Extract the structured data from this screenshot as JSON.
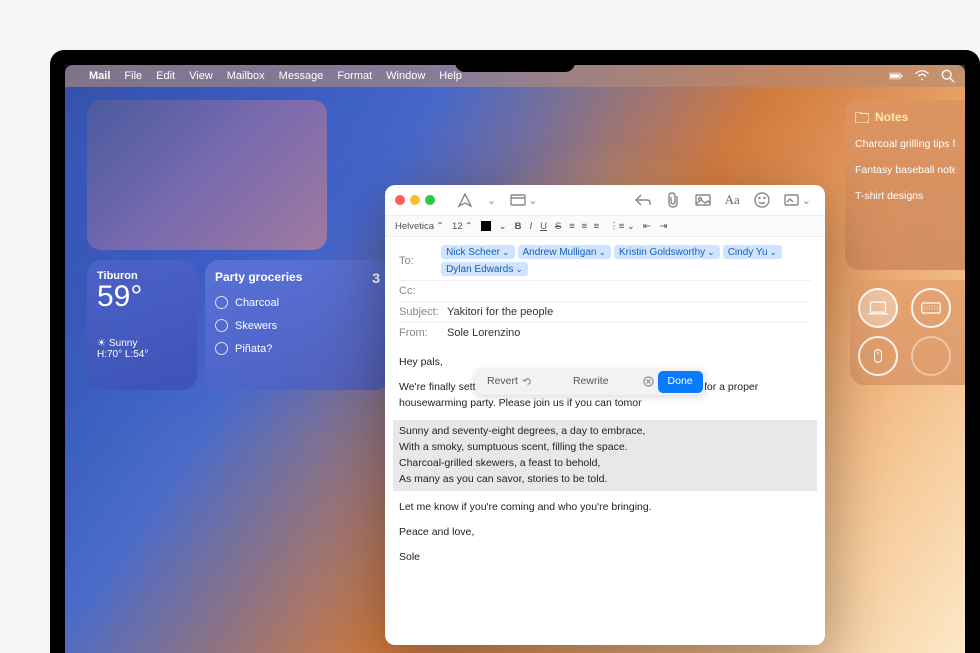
{
  "menubar": {
    "app": "Mail",
    "items": [
      "File",
      "Edit",
      "View",
      "Mailbox",
      "Message",
      "Format",
      "Window",
      "Help"
    ]
  },
  "weather": {
    "location": "Tiburon",
    "temp": "59°",
    "condition": "Sunny",
    "hilo": "H:70° L:54°"
  },
  "reminders": {
    "title": "Party groceries",
    "count": "3",
    "items": [
      "Charcoal",
      "Skewers",
      "Piñata?"
    ]
  },
  "notes": {
    "title": "Notes",
    "items": [
      "Charcoal grilling tips from Si",
      "Fantasy baseball notes",
      "T-shirt designs"
    ]
  },
  "mail": {
    "format_font": "Helvetica",
    "format_size": "12",
    "to_label": "To:",
    "cc_label": "Cc:",
    "subject_label": "Subject:",
    "from_label": "From:",
    "recipients": [
      "Nick Scheer",
      "Andrew Mulligan",
      "Kristin Goldsworthy",
      "Cindy Yu",
      "Dylan Edwards"
    ],
    "subject": "Yakitori for the people",
    "from": "Sole Lorenzino",
    "body": {
      "greeting": "Hey pals,",
      "p1": "We're finally settled into the new place, which means we're ready for a proper housewarming party. Please join us if you can tomor",
      "poem_l1": "Sunny and seventy-eight degrees, a day to embrace,",
      "poem_l2": "With a smoky, sumptuous scent, filling the space.",
      "poem_l3": "Charcoal-grilled skewers, a feast to behold,",
      "poem_l4": "As many as you can savor, stories to be told.",
      "p3": "Let me know if you're coming and who you're bringing.",
      "signoff": "Peace and love,",
      "name": "Sole"
    }
  },
  "ai": {
    "revert": "Revert",
    "rewrite": "Rewrite",
    "done": "Done"
  }
}
